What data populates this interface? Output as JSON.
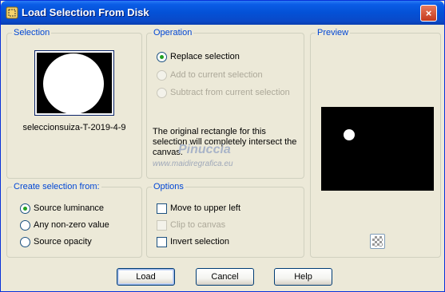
{
  "window": {
    "title": "Load Selection From Disk",
    "close_glyph": "×"
  },
  "selection_group": {
    "legend": "Selection",
    "filename": "seleccionsuiza-T-2019-4-9"
  },
  "operation_group": {
    "legend": "Operation",
    "options": [
      {
        "label": "Replace selection",
        "selected": true,
        "enabled": true
      },
      {
        "label": "Add to current selection",
        "selected": false,
        "enabled": false
      },
      {
        "label": "Subtract from current selection",
        "selected": false,
        "enabled": false
      }
    ],
    "note": "The original rectangle for this selection will completely intersect the canvas."
  },
  "watermark": {
    "line1": "Pinuccia",
    "line2": "www.maidiregrafica.eu"
  },
  "preview_group": {
    "legend": "Preview",
    "background_toggle_icon": "checkerboard-icon"
  },
  "create_from_group": {
    "legend": "Create selection from:",
    "options": [
      {
        "label": "Source luminance",
        "selected": true
      },
      {
        "label": "Any non-zero value",
        "selected": false
      },
      {
        "label": "Source opacity",
        "selected": false
      }
    ]
  },
  "options_group": {
    "legend": "Options",
    "checks": [
      {
        "label": "Move to upper left",
        "checked": false,
        "enabled": true
      },
      {
        "label": "Clip to canvas",
        "checked": false,
        "enabled": false
      },
      {
        "label": "Invert selection",
        "checked": false,
        "enabled": true
      }
    ]
  },
  "buttons": {
    "load": "Load",
    "cancel": "Cancel",
    "help": "Help"
  },
  "colors": {
    "titlebar": "#0451d6",
    "legend_text": "#0046d5",
    "dialog_bg": "#ece9d8",
    "radio_dot": "#21a121"
  }
}
